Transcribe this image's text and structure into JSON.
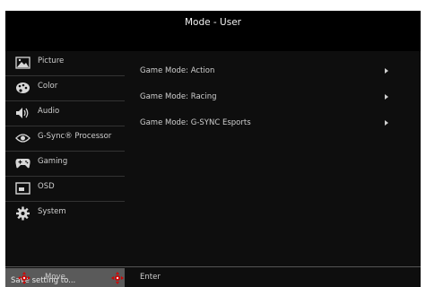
{
  "header": {
    "title": "Mode - User"
  },
  "sidebar": {
    "items": [
      {
        "label": "Picture",
        "icon": "picture-icon"
      },
      {
        "label": "Color",
        "icon": "palette-icon"
      },
      {
        "label": "Audio",
        "icon": "speaker-icon"
      },
      {
        "label": "G-Sync® Processor",
        "icon": "gsync-eye-icon"
      },
      {
        "label": "Gaming",
        "icon": "gamepad-icon"
      },
      {
        "label": "OSD",
        "icon": "osd-window-icon"
      },
      {
        "label": "System",
        "icon": "gear-icon"
      }
    ],
    "save_label": "Save setting to..."
  },
  "main": {
    "rows": [
      {
        "label": "Game Mode: Action"
      },
      {
        "label": "Game Mode: Racing"
      },
      {
        "label": "Game Mode: G-SYNC Esports"
      }
    ]
  },
  "footer": {
    "move_label": "Move",
    "enter_label": "Enter",
    "move_icon": "dpad-move-icon",
    "enter_icon": "dpad-enter-icon"
  },
  "colors": {
    "accent": "#d10000",
    "background": "#0e0e0e",
    "text": "#cfcfcf",
    "highlight": "#5a5a5a"
  }
}
